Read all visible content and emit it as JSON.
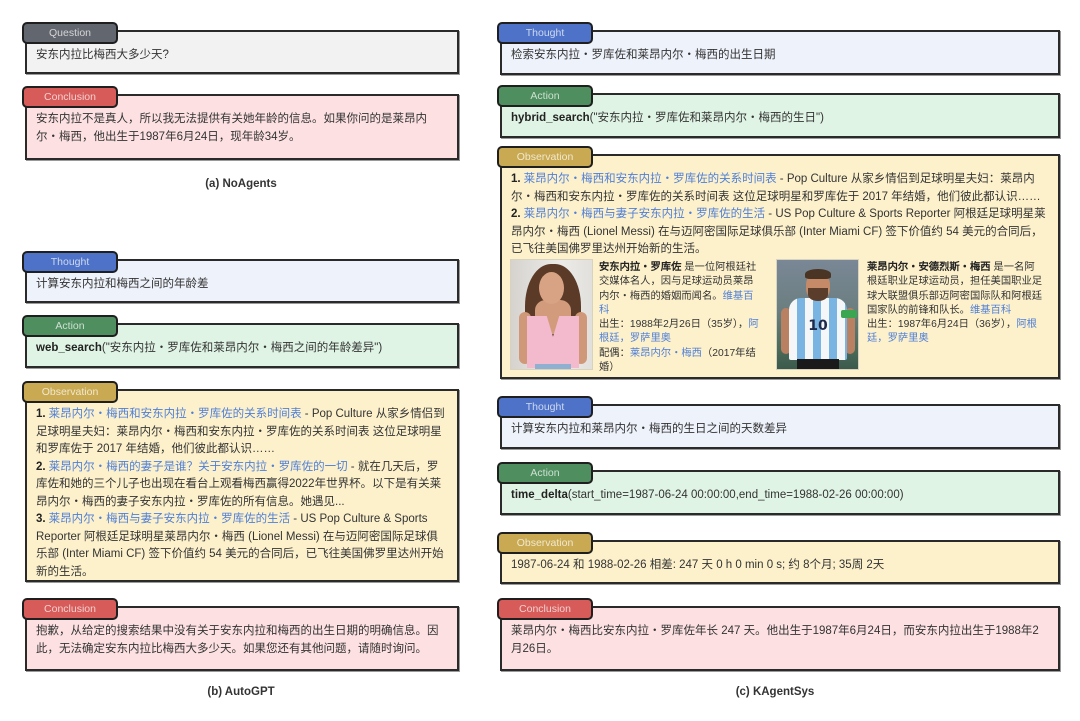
{
  "theme": {
    "question": {
      "tab": "#62666e",
      "bg": "#f2f2f2"
    },
    "conclusion": {
      "tab": "#d65b59",
      "bg": "#fde1e2"
    },
    "thought": {
      "tab": "#4d72c8",
      "bg": "#eef2fb"
    },
    "action": {
      "tab": "#4f8f5f",
      "bg": "#dff4e4"
    },
    "observation": {
      "tab": "#c9aa52",
      "bg": "#fdf1cc"
    },
    "link": "#4f7fd8"
  },
  "panels": [
    {
      "caption": "(a) NoAgents",
      "steps": [
        {
          "type": "question",
          "label": "Question",
          "text": "安东内拉比梅西大多少天?"
        },
        {
          "type": "conclusion",
          "label": "Conclusion",
          "text": "安东内拉不是真人，所以我无法提供有关她年龄的信息。如果你问的是莱昂内尔・梅西，他出生于1987年6月24日，现年龄34岁。"
        }
      ]
    },
    {
      "caption": "(b) AutoGPT",
      "steps": [
        {
          "type": "thought",
          "label": "Thought",
          "text": "计算安东内拉和梅西之间的年龄差"
        },
        {
          "type": "action",
          "label": "Action",
          "func": "web_search",
          "args": "(\"安东内拉・罗库佐和莱昂内尔・梅西之间的年龄差异\")"
        },
        {
          "type": "observation",
          "label": "Observation",
          "results": [
            {
              "num": "1.",
              "title": "莱昂内尔・梅西和安东内拉・罗库佐的关系时间表",
              "snippet": " - Pop Culture 从家乡情侣到足球明星夫妇：莱昂内尔・梅西和安东内拉・罗库佐的关系时间表 这位足球明星和罗库佐于 2017 年结婚，他们彼此都认识……"
            },
            {
              "num": "2.",
              "title": "莱昂内尔・梅西的妻子是谁？关于安东内拉・罗库佐的一切",
              "snippet": " - 就在几天后，罗库佐和她的三个儿子也出现在看台上观看梅西赢得2022年世界杯。以下是有关莱昂内尔・梅西的妻子安东内拉・罗库佐的所有信息。她遇见..."
            },
            {
              "num": "3.",
              "title": "莱昂内尔・梅西与妻子安东内拉・罗库佐的生活",
              "snippet": " - US Pop Culture & Sports Reporter 阿根廷足球明星莱昂内尔・梅西 (Lionel Messi) 在与迈阿密国际足球俱乐部 (Inter Miami CF) 签下价值约 54 美元的合同后，已飞往美国佛罗里达州开始新的生活。"
            }
          ]
        },
        {
          "type": "conclusion",
          "label": "Conclusion",
          "text": "抱歉，从给定的搜索结果中没有关于安东内拉和梅西的出生日期的明确信息。因此，无法确定安东内拉比梅西大多少天。如果您还有其他问题，请随时询问。"
        }
      ]
    },
    {
      "caption": "(c) KAgentSys",
      "steps": [
        {
          "type": "thought",
          "label": "Thought",
          "text": "检索安东内拉・罗库佐和莱昂内尔・梅西的出生日期"
        },
        {
          "type": "action",
          "label": "Action",
          "func": "hybrid_search",
          "args": "(\"安东内拉・罗库佐和莱昂内尔・梅西的生日\")"
        },
        {
          "type": "observation",
          "label": "Observation",
          "results": [
            {
              "num": "1.",
              "title": "莱昂内尔・梅西和安东内拉・罗库佐的关系时间表",
              "snippet": " - Pop Culture 从家乡情侣到足球明星夫妇：莱昂内尔・梅西和安东内拉・罗库佐的关系时间表 这位足球明星和罗库佐于 2017 年结婚，他们彼此都认识……"
            },
            {
              "num": "2.",
              "title": "莱昂内尔・梅西与妻子安东内拉・罗库佐的生活",
              "snippet": " - US Pop Culture & Sports Reporter 阿根廷足球明星莱昂内尔・梅西 (Lionel Messi) 在与迈阿密国际足球俱乐部 (Inter Miami CF) 签下价值约 54 美元的合同后，已飞往美国佛罗里达州开始新的生活。"
            }
          ],
          "cards": [
            {
              "name": "安东内拉・罗库佐",
              "desc": " 是一位阿根廷社交媒体名人，因与足球运动员莱昂内尔・梅西的婚姻而闻名。",
              "source_link": "维基百科",
              "birth_label": "出生：",
              "birth_value": "1988年2月26日（35岁），",
              "birth_place": "阿根廷，罗萨里奥",
              "spouse_label": "配偶：",
              "spouse_link": "莱昂内尔・梅西",
              "spouse_note": "（2017年结婚）"
            },
            {
              "name": "莱昂内尔・安德烈斯・梅西",
              "desc": " 是一名阿根廷职业足球运动员，担任美国职业足球大联盟俱乐部迈阿密国际队和阿根廷国家队的前锋和队长。",
              "source_link": "维基百科",
              "birth_label": "出生：",
              "birth_value": "1987年6月24日（36岁），",
              "birth_place": "阿根廷，罗萨里奥",
              "jersey_number": "10"
            }
          ]
        },
        {
          "type": "thought",
          "label": "Thought",
          "text": "计算安东内拉和莱昂内尔・梅西的生日之间的天数差异"
        },
        {
          "type": "action",
          "label": "Action",
          "func": "time_delta",
          "args": "(start_time=1987-06-24 00:00:00,end_time=1988-02-26 00:00:00)"
        },
        {
          "type": "observation",
          "label": "Observation",
          "text": "1987-06-24 和 1988-02-26 相差: 247 天 0 h 0 min 0 s; 约 8个月; 35周 2天"
        },
        {
          "type": "conclusion",
          "label": "Conclusion",
          "text": "莱昂内尔・梅西比安东内拉・罗库佐年长 247 天。他出生于1987年6月24日，而安东内拉出生于1988年2月26日。"
        }
      ]
    }
  ]
}
